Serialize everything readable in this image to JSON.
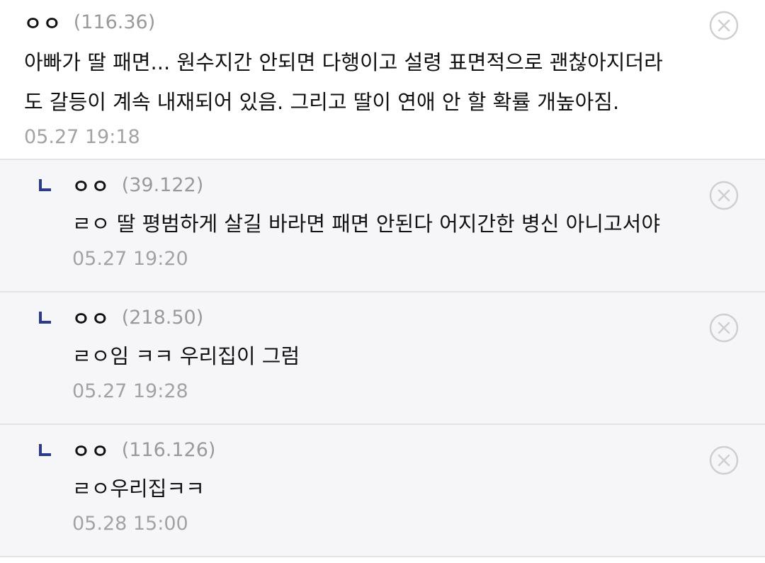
{
  "comments": [
    {
      "nick": "ㅇㅇ",
      "ip": "(116.36)",
      "lines": [
        "아빠가 딸 패면... 원수지간 안되면 다행이고 설령 표면적으로 괜찮아지더라",
        "도 갈등이 계속 내재되어 있음. 그리고 딸이 연애 안 할 확률 개높아짐."
      ],
      "date": "05.27 19:18"
    },
    {
      "nick": "ㅇㅇ",
      "ip": "(39.122)",
      "lines": [
        "ㄹㅇ 딸 평범하게 살길 바라면 패면 안된다 어지간한 병신 아니고서야"
      ],
      "date": "05.27 19:20"
    },
    {
      "nick": "ㅇㅇ",
      "ip": "(218.50)",
      "lines": [
        "ㄹㅇ임 ㅋㅋ 우리집이 그럼"
      ],
      "date": "05.27 19:28"
    },
    {
      "nick": "ㅇㅇ",
      "ip": "(116.126)",
      "lines": [
        "ㄹㅇ우리집ㅋㅋ"
      ],
      "date": "05.28 15:00"
    }
  ],
  "icons": {
    "reply": "reply-arrow-icon",
    "delete": "close-circle-icon"
  },
  "colors": {
    "reply_mark": "#2c3a8c",
    "meta_gray": "#9a9a9a",
    "reply_bg": "#f6f6f8",
    "divider": "#e3e3e3"
  }
}
